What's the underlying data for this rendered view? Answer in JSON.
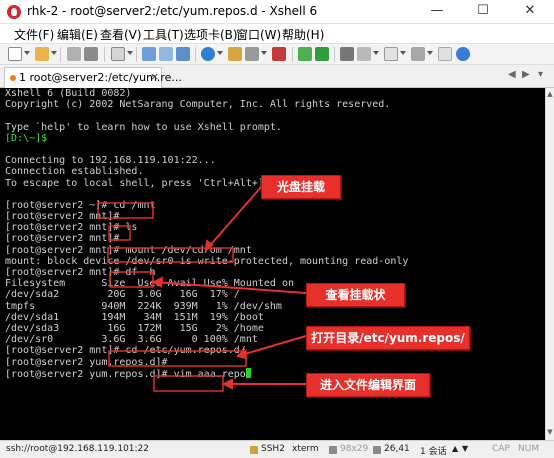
{
  "window": {
    "title": "rhk-2 - root@server2:/etc/yum.repos.d - Xshell 6",
    "min_glyph": "—",
    "max_glyph": "☐",
    "close_glyph": "✕"
  },
  "menu": [
    "文件(F)",
    "编辑(E)",
    "查看(V)",
    "工具(T)",
    "选项卡(B)",
    "窗口(W)",
    "帮助(H)"
  ],
  "tab": {
    "label": "1 root@server2:/etc/yum.re...",
    "close": "×",
    "prev": "◀",
    "next": "▶",
    "list": "▾"
  },
  "terminal": {
    "lines": [
      {
        "text": "Xshell 6 (Build 0082)"
      },
      {
        "text": "Copyright (c) 2002 NetSarang Computer, Inc. All rights reserved."
      },
      {
        "text": ""
      },
      {
        "text": "Type `help' to learn how to use Xshell prompt."
      },
      {
        "text": "[D:\\~]$",
        "green": true
      },
      {
        "text": ""
      },
      {
        "text": "Connecting to 192.168.119.101:22..."
      },
      {
        "text": "Connection established."
      },
      {
        "text": "To escape to local shell, press 'Ctrl+Alt+]'."
      },
      {
        "text": ""
      },
      {
        "text": "[root@server2 ~]# cd /mnt"
      },
      {
        "text": "[root@server2 mnt]#"
      },
      {
        "text": "[root@server2 mnt]# ls"
      },
      {
        "text": "[root@server2 mnt]#"
      },
      {
        "text": "[root@server2 mnt]# mount /dev/cdrom /mnt"
      },
      {
        "text": "mount: block device /dev/sr0 is write-protected, mounting read-only"
      },
      {
        "text": "[root@server2 mnt]# df -h"
      },
      {
        "text": "Filesystem      Size  Used Avail Use% Mounted on"
      },
      {
        "text": "/dev/sda2        20G  3.0G   16G  17% /"
      },
      {
        "text": "tmpfs           940M  224K  939M   1% /dev/shm"
      },
      {
        "text": "/dev/sda1       194M   34M  151M  19% /boot"
      },
      {
        "text": "/dev/sda3        16G  172M   15G   2% /home"
      },
      {
        "text": "/dev/sr0        3.6G  3.6G     0 100% /mnt"
      },
      {
        "text": "[root@server2 mnt]# cd /etc/yum.repos.d/"
      },
      {
        "text": "[root@server2 yum.repos.d]#"
      },
      {
        "text": "[root@server2 yum.repos.d]# vim aaa.repo",
        "cursor": true
      }
    ]
  },
  "annotations": {
    "mount_cd": "光盘挂载",
    "check_mount": "查看挂载状",
    "open_dir": "打开目录/etc/yum.repos/",
    "edit_file": "进入文件编辑界面",
    "box_color": "#e6302c"
  },
  "statusbar": {
    "connection": "ssh://root@192.168.119.101:22",
    "protocol": "SSH2",
    "terminal_type": "xterm",
    "size": "98x29",
    "position": "26,41",
    "sessions": "1 会话",
    "cap": "CAP",
    "num": "NUM"
  },
  "colors": {
    "terminal_bg": "#000000",
    "terminal_fg": "#cfcfcf",
    "prompt_green": "#38e838",
    "tab_dot": "#ef7b1a"
  }
}
